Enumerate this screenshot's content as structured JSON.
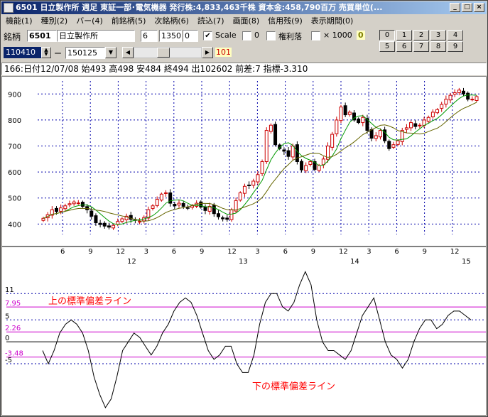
{
  "window": {
    "title": "6501 日立製作所  週足  東証一部･電気機器  発行株:4,833,463千株  資本金:458,790百万  売買単位(..."
  },
  "title_buttons": {
    "minimize": "_",
    "maximize": "□",
    "close": "×"
  },
  "menu": [
    {
      "label": "機能(1)"
    },
    {
      "label": "種別(2)"
    },
    {
      "label": "バー(4)"
    },
    {
      "label": "前銘柄(5)"
    },
    {
      "label": "次銘柄(6)"
    },
    {
      "label": "読込(7)"
    },
    {
      "label": "画面(8)"
    },
    {
      "label": "信用残(9)"
    },
    {
      "label": "表示期間(0)"
    }
  ],
  "toolbar": {
    "code_label": "銘柄",
    "code_value": "6501",
    "name_value": "日立製作所",
    "field_a": "6",
    "field_b": "1350",
    "field_c": "0",
    "scale_checked": "✔",
    "scale_label": "Scale",
    "zero_label": "0",
    "rights_label": "権利落",
    "times_label": "× 1000",
    "tag_value": "0",
    "number_buttons": [
      "0",
      "1",
      "2",
      "3",
      "4",
      "5",
      "6",
      "7",
      "8",
      "9"
    ],
    "selected_number": "0",
    "date_from": "110410",
    "dash": "ー",
    "date_to": "150125",
    "dropdown_arrow": "▼",
    "scroll_left": "◀",
    "scroll_right": "▶",
    "bars_value": "101"
  },
  "status_line": "166:日付12/07/08 始493 高498 安484 終494 出102602 前差:7 指標-3.310",
  "colors": {
    "up_candle": "#cc0000",
    "down_candle": "#000000",
    "grid": "#0000aa",
    "ma_short": "#009900",
    "ma_long": "#666600",
    "band": "#cc00cc",
    "annotation": "#ff0000"
  },
  "chart_data": [
    {
      "type": "candlestick",
      "title": "",
      "yticks": [
        "900",
        "800",
        "700",
        "600",
        "500",
        "400"
      ],
      "ylim": [
        360,
        950
      ],
      "x_month_labels": [
        "6",
        "9",
        "12",
        "3",
        "6",
        "9",
        "12",
        "3",
        "6",
        "9",
        "12",
        "3",
        "6",
        "9",
        "12"
      ],
      "x_year_labels": [
        "12",
        "13",
        "14",
        "15"
      ],
      "close": [
        422,
        436,
        455,
        448,
        462,
        470,
        478,
        485,
        481,
        468,
        455,
        430,
        405,
        398,
        392,
        388,
        395,
        410,
        420,
        430,
        418,
        415,
        410,
        425,
        455,
        470,
        495,
        515,
        520,
        480,
        470,
        480,
        468,
        462,
        470,
        480,
        465,
        452,
        468,
        440,
        428,
        420,
        418,
        455,
        490,
        520,
        545,
        548,
        565,
        590,
        640,
        760,
        780,
        705,
        690,
        680,
        660,
        700,
        640,
        608,
        625,
        640,
        610,
        625,
        650,
        700,
        745,
        800,
        850,
        820,
        830,
        800,
        790,
        810,
        760,
        730,
        740,
        760,
        720,
        690,
        705,
        720,
        760,
        770,
        790,
        775,
        780,
        800,
        810,
        830,
        840,
        860,
        880,
        895,
        905,
        915,
        900,
        880,
        880,
        890
      ]
    },
    {
      "type": "line",
      "title": "",
      "yticks": [
        "11",
        "7.95",
        "5",
        "2.26",
        "0",
        "-3.48",
        "-5"
      ],
      "ylim": [
        -16,
        18
      ],
      "band_upper": 7.95,
      "band_center": 2.26,
      "band_lower": -3.48,
      "annotation_upper": "上の標準偏差ライン",
      "annotation_lower": "下の標準偏差ライン",
      "values": [
        -2,
        -5,
        -2,
        2,
        4,
        5,
        4,
        2,
        -2,
        -8,
        -12,
        -15,
        -13,
        -8,
        -2,
        0,
        2,
        1,
        -1,
        -3,
        -1,
        2,
        4,
        7,
        9,
        10,
        9,
        6,
        2,
        -2,
        -4,
        -3,
        -1,
        -1,
        -5,
        -7,
        -7,
        -3,
        4,
        9,
        11,
        11,
        8,
        7,
        9,
        13,
        16,
        13,
        5,
        0,
        -2,
        -2,
        -3,
        -4,
        -2,
        2,
        6,
        8,
        10,
        5,
        0,
        -3,
        -4,
        -6,
        -4,
        0,
        3,
        5,
        5,
        3,
        4,
        6,
        7,
        7,
        6,
        5
      ]
    }
  ]
}
